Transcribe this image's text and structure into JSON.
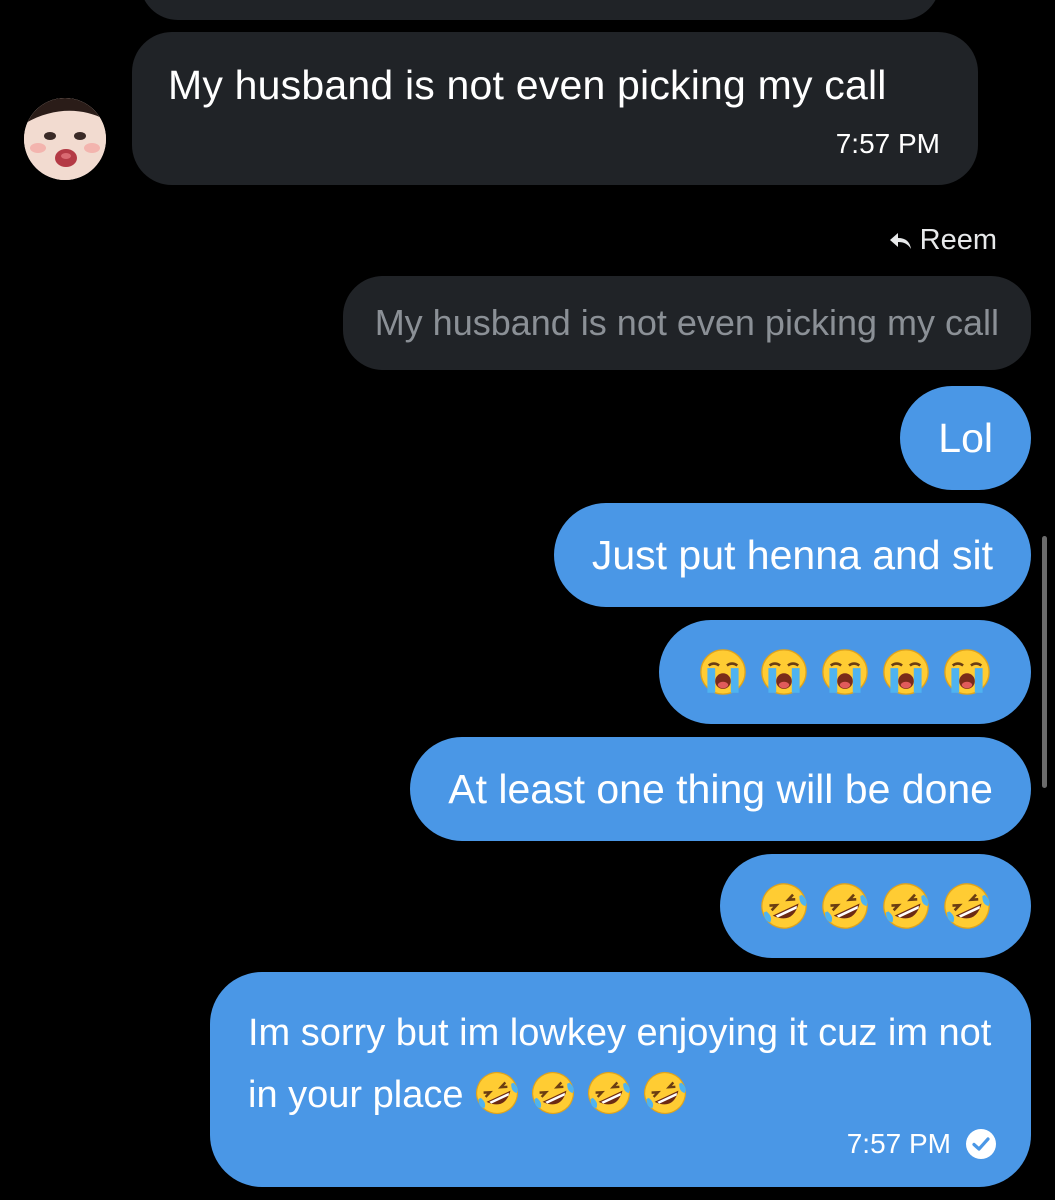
{
  "received": {
    "text": "My husband is not even picking my call",
    "time": "7:57 PM"
  },
  "reply": {
    "to_name": "Reem",
    "quoted_text": "My husband is not even picking my call"
  },
  "sent_messages": [
    {
      "text": "Lol"
    },
    {
      "text": "Just put henna and sit"
    },
    {
      "emoji": "loudly-crying-face",
      "count": 5
    },
    {
      "text": "At least one thing will be done"
    },
    {
      "emoji": "rolling-on-floor-laughing",
      "count": 4
    },
    {
      "text": "Im sorry but im lowkey enjoying it cuz im not in your place",
      "emoji": "rolling-on-floor-laughing",
      "count": 4,
      "time": "7:57 PM"
    }
  ],
  "colors": {
    "background": "#000000",
    "received_bubble": "#202327",
    "sent_bubble": "#4a97e6"
  }
}
